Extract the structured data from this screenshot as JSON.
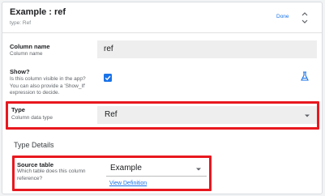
{
  "header": {
    "title": "Example : ref",
    "subtitle": "type: Ref",
    "done_label": "Done"
  },
  "column_name": {
    "label": "Column name",
    "description": "Column name",
    "value": "ref"
  },
  "show": {
    "label": "Show?",
    "description": "Is this column visible in the app? You can also provide a 'Show_If' expression to decide.",
    "checked": true
  },
  "type": {
    "label": "Type",
    "description": "Column data type",
    "value": "Ref"
  },
  "type_details": {
    "section_title": "Type Details"
  },
  "source_table": {
    "label": "Source table",
    "description": "Which table does this column reference?",
    "value": "Example",
    "link_label": "View Definition"
  },
  "colors": {
    "accent": "#1a73e8",
    "highlight": "#e8181e",
    "field_bg": "#eeeeee"
  }
}
